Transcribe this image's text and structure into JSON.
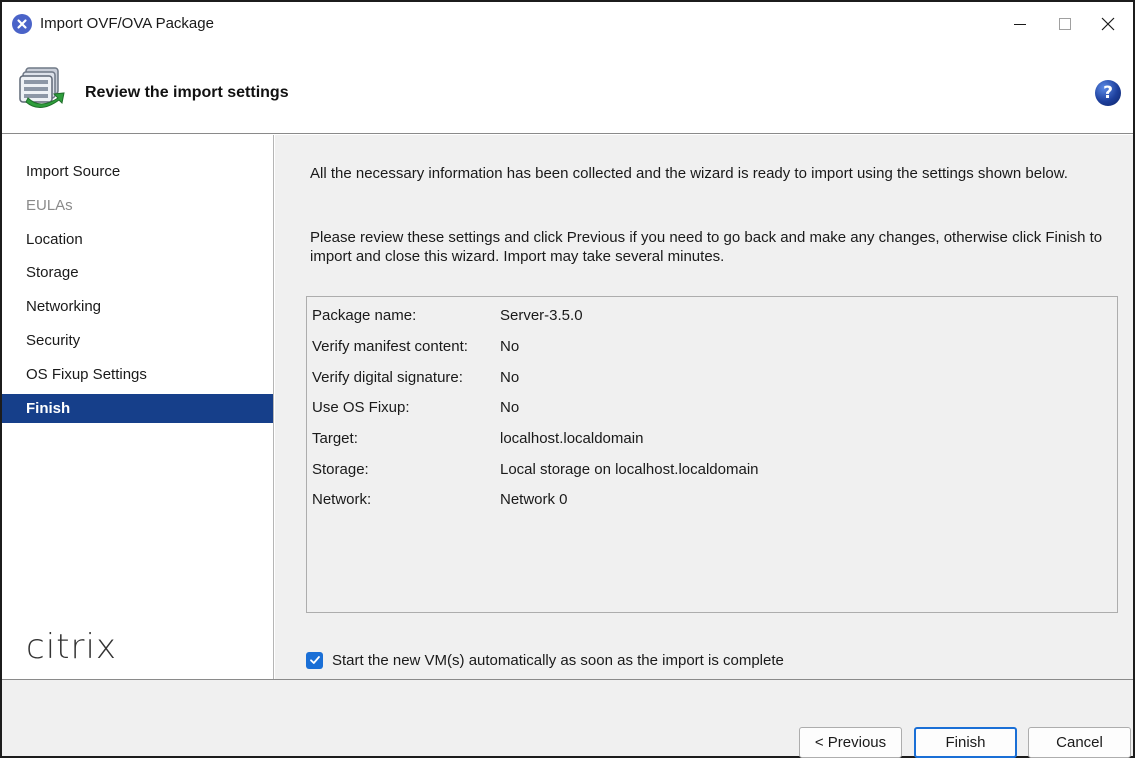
{
  "window": {
    "title": "Import OVF/OVA Package"
  },
  "header": {
    "title": "Review the import settings",
    "help_icon_glyph": "?"
  },
  "sidebar": {
    "items": [
      {
        "label": "Import Source",
        "state": "normal"
      },
      {
        "label": "EULAs",
        "state": "disabled"
      },
      {
        "label": "Location",
        "state": "normal"
      },
      {
        "label": "Storage",
        "state": "normal"
      },
      {
        "label": "Networking",
        "state": "normal"
      },
      {
        "label": "Security",
        "state": "normal"
      },
      {
        "label": "OS Fixup Settings",
        "state": "normal"
      },
      {
        "label": "Finish",
        "state": "active"
      }
    ],
    "brand": "citrix"
  },
  "main": {
    "intro": "All the necessary information has been collected and the wizard is ready to import using the settings shown below.",
    "instructions": "Please review these settings and click Previous if you need to go back and make any changes, otherwise click Finish to import and close this wizard. Import may take several minutes.",
    "settings": [
      {
        "label": "Package name:",
        "value": "Server-3.5.0"
      },
      {
        "label": "Verify manifest content:",
        "value": "No"
      },
      {
        "label": "Verify digital signature:",
        "value": "No"
      },
      {
        "label": "Use OS Fixup:",
        "value": "No"
      },
      {
        "label": "Target:",
        "value": "localhost.localdomain"
      },
      {
        "label": "Storage:",
        "value": "Local storage on localhost.localdomain"
      },
      {
        "label": "Network:",
        "value": "Network 0"
      }
    ],
    "start_vm_checkbox": {
      "label": "Start the new VM(s) automatically as soon as the import is complete",
      "checked": true
    }
  },
  "footer": {
    "previous_label": "< Previous",
    "finish_label": "Finish",
    "cancel_label": "Cancel"
  },
  "icons": {
    "app": "citrix-close-circle-icon",
    "header": "vm-import-icon",
    "help": "help-icon",
    "minimize": "minimize-icon",
    "maximize": "maximize-icon",
    "close": "close-icon"
  },
  "colors": {
    "active_nav": "#163f8a",
    "accent": "#1a6fd6",
    "app_icon": "#4a63c8"
  }
}
